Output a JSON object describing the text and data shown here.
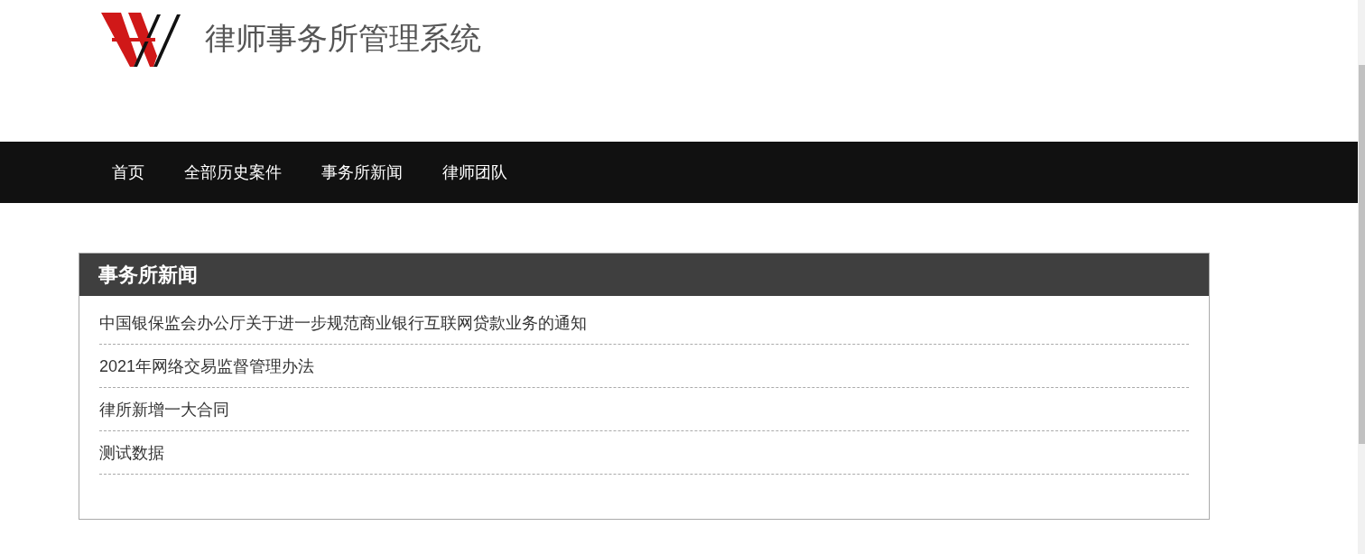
{
  "header": {
    "title": "律师事务所管理系统"
  },
  "nav": {
    "items": [
      {
        "label": "首页"
      },
      {
        "label": "全部历史案件"
      },
      {
        "label": "事务所新闻"
      },
      {
        "label": "律师团队"
      }
    ]
  },
  "news_panel": {
    "title": "事务所新闻",
    "items": [
      "中国银保监会办公厅关于进一步规范商业银行互联网贷款业务的通知",
      "2021年网络交易监督管理办法",
      "律所新增一大合同",
      "测试数据"
    ]
  }
}
